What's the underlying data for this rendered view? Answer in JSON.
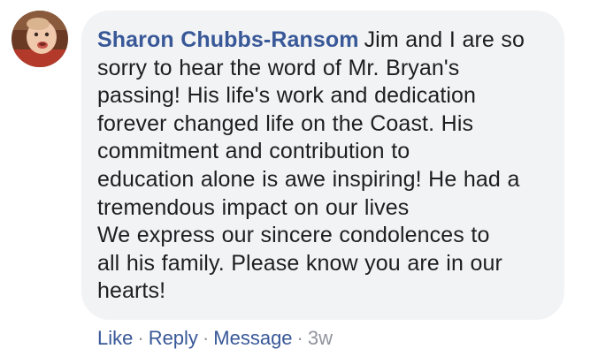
{
  "comment": {
    "author": "Sharon Chubbs-Ransom",
    "text_lines": [
      "Jim and I are so",
      "sorry to hear the word of Mr. Bryan's",
      "passing! His life's work and dedication",
      "forever changed life on the Coast. His",
      "commitment and contribution to",
      "education alone is awe inspiring! He had a",
      "tremendous impact on our lives",
      "We express our sincere condolences to",
      "all his family. Please know you are in our",
      "hearts!"
    ],
    "avatar_icon": "profile-photo-icon"
  },
  "actions": {
    "like_label": "Like",
    "reply_label": "Reply",
    "message_label": "Message",
    "separator": "·",
    "timestamp": "3w"
  },
  "colors": {
    "author": "#385898",
    "bubble": "#f2f3f5",
    "text": "#1c1e21",
    "meta": "#90949c"
  }
}
